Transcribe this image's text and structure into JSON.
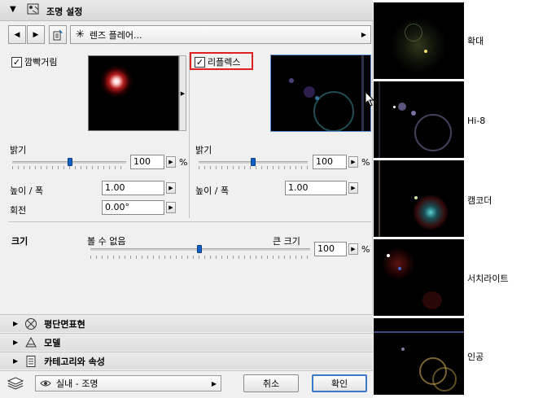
{
  "header": {
    "title": "조명 설정"
  },
  "toolbar": {
    "lens_dropdown": "렌즈 플레어..."
  },
  "glow": {
    "label": "깜빡거림",
    "checked": true,
    "brightness_label": "밝기",
    "brightness_value": "100",
    "brightness_level": 1.0,
    "unit": "%",
    "height_width_label": "높이 / 폭",
    "height_width_value": "1.00",
    "rotation_label": "회전",
    "rotation_value": "0.00°"
  },
  "reflex": {
    "label": "리플렉스",
    "checked": true,
    "brightness_label": "밝기",
    "brightness_value": "100",
    "brightness_level": 1.0,
    "unit": "%",
    "height_width_label": "높이 / 폭",
    "height_width_value": "1.00"
  },
  "size": {
    "label": "크기",
    "min_label": "볼 수 없음",
    "max_label": "큰 크기",
    "value": "100",
    "unit": "%"
  },
  "sections": [
    {
      "label": "평단면표현",
      "icon": "cross-circle-icon"
    },
    {
      "label": "모델",
      "icon": "model-icon"
    },
    {
      "label": "카테고리와 속성",
      "icon": "document-icon"
    }
  ],
  "footer": {
    "layer_dropdown": "실내 - 조명",
    "cancel_label": "취소",
    "ok_label": "확인"
  },
  "lens_presets": [
    {
      "label": "확대"
    },
    {
      "label": "Hi-8"
    },
    {
      "label": "캠코더"
    },
    {
      "label": "서치라이트"
    },
    {
      "label": "인공"
    }
  ],
  "colors": {
    "accent": "#1060c8",
    "highlight_border": "#e02020",
    "panel_bg": "#f0f0f0"
  }
}
